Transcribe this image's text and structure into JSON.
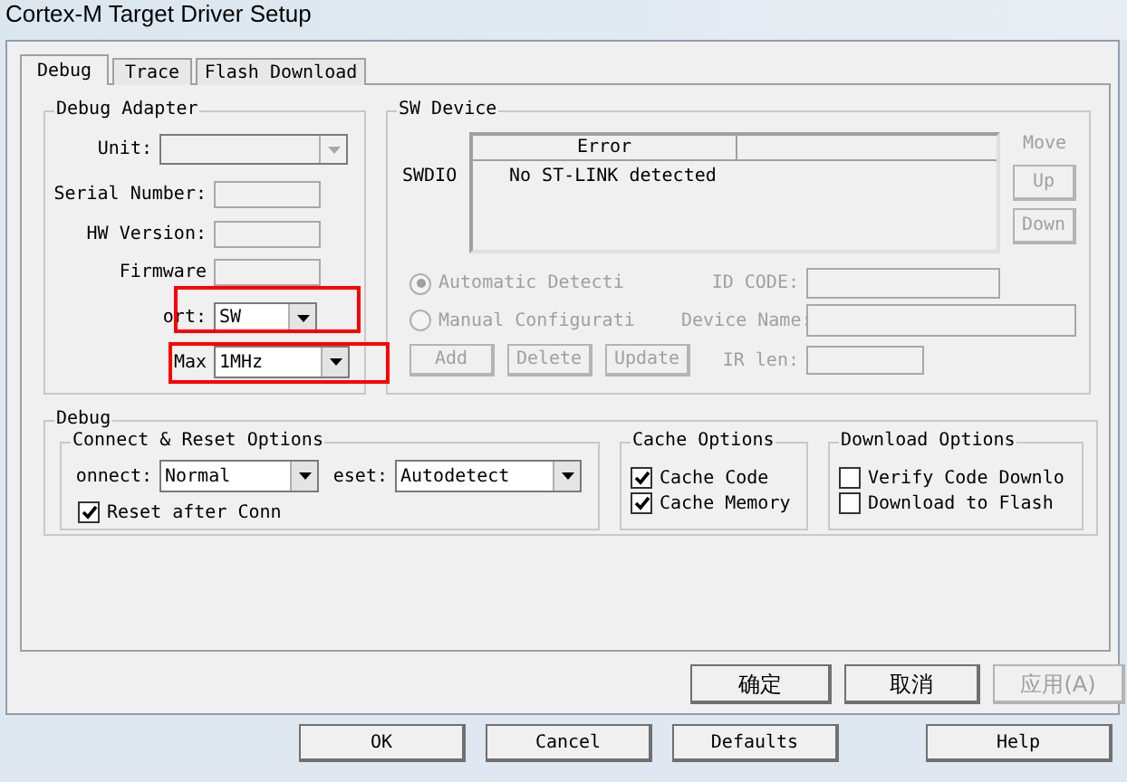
{
  "window": {
    "title": "Cortex-M Target Driver Setup"
  },
  "tabs": [
    {
      "label": "Debug",
      "selected": true
    },
    {
      "label": "Trace",
      "selected": false
    },
    {
      "label": "Flash Download",
      "selected": false
    }
  ],
  "debug_adapter": {
    "title": "Debug Adapter",
    "unit": {
      "label": "Unit:",
      "disabled": true
    },
    "fields": [
      {
        "label": "Serial Number:"
      },
      {
        "label": "HW Version:"
      },
      {
        "label": "Firmware"
      }
    ],
    "port": {
      "label": "ort:",
      "value": "SW",
      "highlighted": true
    },
    "max_clock": {
      "label": "Max",
      "value": "1MHz",
      "highlighted": true
    }
  },
  "sw_device": {
    "title": "SW Device",
    "row_label": "SWDIO",
    "columns": [
      "Error"
    ],
    "rows": [
      {
        "error": "No ST-LINK detected"
      }
    ],
    "move": {
      "label": "Move",
      "buttons": [
        {
          "label": "Up",
          "disabled": true
        },
        {
          "label": "Down",
          "disabled": true
        }
      ]
    },
    "modes": [
      {
        "label": "Automatic Detecti",
        "selected": true,
        "disabled": true
      },
      {
        "label": "Manual Configurati",
        "selected": false,
        "disabled": true
      }
    ],
    "fields": [
      {
        "label": "ID CODE:"
      },
      {
        "label": "Device Name:"
      },
      {
        "label": "IR len:"
      }
    ],
    "buttons": [
      {
        "label": "Add",
        "disabled": true
      },
      {
        "label": "Delete",
        "disabled": true
      },
      {
        "label": "Update",
        "disabled": true
      }
    ]
  },
  "debug": {
    "title": "Debug",
    "connect_reset": {
      "title": "Connect & Reset Options",
      "connect": {
        "label": "onnect:",
        "value": "Normal"
      },
      "reset": {
        "label": "eset:",
        "value": "Autodetect"
      },
      "reset_after_connect": {
        "label": "Reset after Conn",
        "checked": true
      }
    },
    "cache_options": {
      "title": "Cache Options",
      "items": [
        {
          "label": "Cache Code",
          "checked": true
        },
        {
          "label": "Cache Memory",
          "checked": true
        }
      ]
    },
    "download_options": {
      "title": "Download Options",
      "items": [
        {
          "label": "Verify Code Downlo",
          "checked": false
        },
        {
          "label": "Download to Flash",
          "checked": false
        }
      ]
    }
  },
  "dialog_buttons": [
    {
      "label": "确定",
      "disabled": false
    },
    {
      "label": "取消",
      "disabled": false
    },
    {
      "label": "应用(A)",
      "disabled": true
    }
  ],
  "background_buttons": [
    {
      "label": "OK"
    },
    {
      "label": "Cancel"
    },
    {
      "label": "Defaults"
    },
    {
      "label": "Help"
    }
  ]
}
